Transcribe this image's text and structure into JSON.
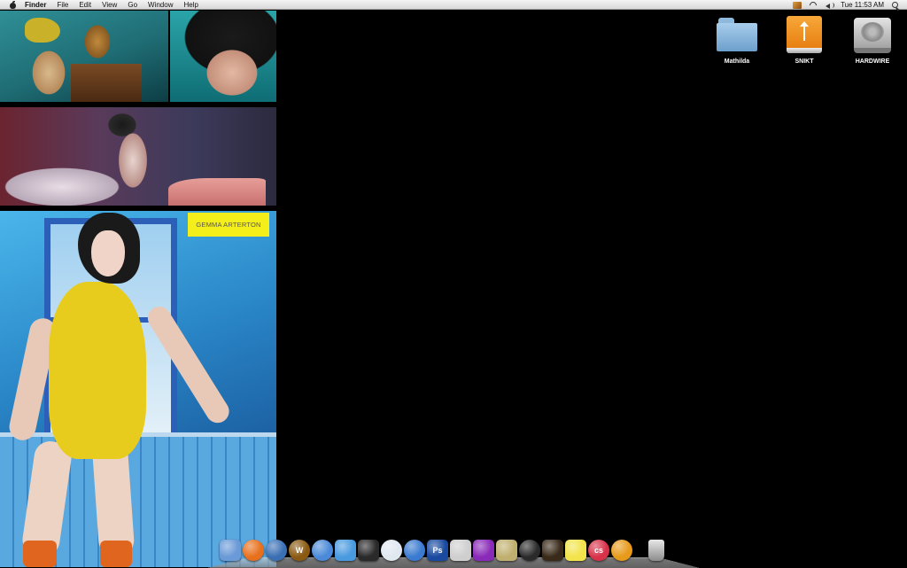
{
  "menubar": {
    "app_name": "Finder",
    "menus": [
      "File",
      "Edit",
      "View",
      "Go",
      "Window",
      "Help"
    ],
    "clock": "Tue 11:53 AM"
  },
  "wallpaper": {
    "caption": "GEMMA ARTERTON"
  },
  "desktop_icons": [
    {
      "label": "Mathilda",
      "icon": "folder-icon"
    },
    {
      "label": "SNIKT",
      "icon": "usb-drive-icon"
    },
    {
      "label": "HARDWIRE",
      "icon": "hard-drive-icon"
    }
  ],
  "dock": {
    "items": [
      {
        "name": "finder-icon",
        "color": "#6a9ad8"
      },
      {
        "name": "firefox-icon",
        "color": "#e8701c"
      },
      {
        "name": "mail-icon",
        "color": "#3a6fb4"
      },
      {
        "name": "world-of-warcraft-icon",
        "color": "#8a5a12",
        "mark": "W"
      },
      {
        "name": "itunes-icon",
        "color": "#4a8ad8"
      },
      {
        "name": "word-processor-icon",
        "color": "#4a9ae0"
      },
      {
        "name": "adium-duck-icon",
        "color": "#2a2a2a"
      },
      {
        "name": "skype-icon",
        "color": "#e0e8f0"
      },
      {
        "name": "safari-icon",
        "color": "#3a7ad0"
      },
      {
        "name": "photoshop-icon",
        "color": "#1a4aa0",
        "mark": "Ps"
      },
      {
        "name": "system-preferences-icon",
        "color": "#cfcfcf"
      },
      {
        "name": "purple-app-icon",
        "color": "#8a2ab8"
      },
      {
        "name": "transmit-truck-icon",
        "color": "#c0b070"
      },
      {
        "name": "burn-icon",
        "color": "#2a2a2a"
      },
      {
        "name": "cocktail-icon",
        "color": "#3a2a1a"
      },
      {
        "name": "stickies-icon",
        "color": "#f2e44a"
      },
      {
        "name": "lastfm-icon",
        "color": "#d8324a",
        "mark": "cs"
      },
      {
        "name": "growl-icon",
        "color": "#e89a1a"
      }
    ],
    "trash": {
      "name": "trash-icon"
    }
  }
}
